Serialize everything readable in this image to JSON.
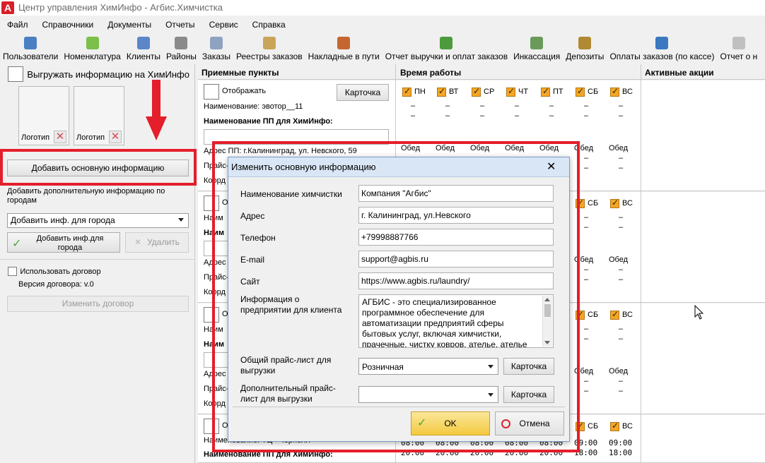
{
  "window": {
    "title": "Центр управления ХимИнфо - Агбис.Химчистка",
    "app_icon_letter": "A"
  },
  "menu": [
    "Файл",
    "Справочники",
    "Документы",
    "Отчеты",
    "Сервис",
    "Справка"
  ],
  "toolbar": [
    {
      "label": "Пользователи",
      "icon": "users-icon",
      "color": "#4a7fc1"
    },
    {
      "label": "Номенклатура",
      "icon": "catalog-icon",
      "color": "#7cbf4a"
    },
    {
      "label": "Клиенты",
      "icon": "client-icon",
      "color": "#5a87c8"
    },
    {
      "label": "Районы",
      "icon": "districts-icon",
      "color": "#8a8a8a"
    },
    {
      "label": "Заказы",
      "icon": "orders-icon",
      "color": "#8fa3c0"
    },
    {
      "label": "Реестры заказов",
      "icon": "registry-icon",
      "color": "#c9a55a"
    },
    {
      "label": "Накладные в пути",
      "icon": "truck-icon",
      "color": "#c4662f"
    },
    {
      "label": "Отчет выручки и оплат заказов",
      "icon": "books-icon",
      "color": "#4d9a3d"
    },
    {
      "label": "Инкассация",
      "icon": "money-icon",
      "color": "#6b9b5a"
    },
    {
      "label": "Депозиты",
      "icon": "deposit-icon",
      "color": "#b08a33"
    },
    {
      "label": "Оплаты заказов (по кассе)",
      "icon": "cashbox-icon",
      "color": "#3c78c0"
    },
    {
      "label": "Отчет о н",
      "icon": "report-icon",
      "color": "#c0c0c0"
    }
  ],
  "left": {
    "export_label": "Выгружать информацию на ХимИнфо",
    "logo_label": "Логотип",
    "add_main_btn": "Добавить основную информацию",
    "add_extra_text": "Добавить дополнительную информацию по городам",
    "city_select": "Добавить инф. для города",
    "add_city_btn": "Добавить инф.для города",
    "delete_btn": "Удалить",
    "use_contract": "Использовать договор",
    "contract_version": "Версия договора: v.0",
    "change_contract_btn": "Изменить договор"
  },
  "grid": {
    "col_points": "Приемные пункты",
    "col_hours": "Время работы",
    "col_promos": "Активные акции",
    "days": [
      "ПН",
      "ВТ",
      "СР",
      "ЧТ",
      "ПТ",
      "СБ",
      "ВС"
    ],
    "show_label": "Отображать",
    "card_btn": "Карточка",
    "name_row1": "Наименование: эвотор__11",
    "pp_name_label": "Наименование ПП для ХимИнфо:",
    "address_row1": "Адрес ПП: г.Калининград, ул. Невского, 59",
    "price_frag": "Прайс-",
    "coord_frag": "Коорд",
    "name_frag": "Наим",
    "addr_frag": "Адрес",
    "show_frag": "Ото",
    "lunch": "Обед",
    "dash": "–",
    "name_row4": "Наименование: ТЦ «Чернолл»",
    "times_open": "08:00",
    "times_close": "20:00",
    "sat_open": "09:00",
    "sat_close": "18:00",
    "sun_open": "09:00",
    "sun_close": "18:00"
  },
  "modal": {
    "title": "Изменить основную информацию",
    "fields": {
      "name_label": "Наименование химчистки",
      "name_value": "Компания \"Агбис\"",
      "address_label": "Адрес",
      "address_value": "г. Калининград, ул.Невского",
      "phone_label": "Телефон",
      "phone_value": "+79998887766",
      "email_label": "E-mail",
      "email_value": "support@agbis.ru",
      "site_label": "Сайт",
      "site_value": "https://www.agbis.ru/laundry/",
      "info_label": "Информация о предприятии для клиента",
      "info_value": "АГБИС - это специализированное программное обеспечение для автоматизации предприятий сферы бытовых услуг, включая химчистки, прачечные, чистку ковров, ателье, ателье по",
      "price_label": "Общий прайс-лист для выгрузки",
      "price_value": "Розничная",
      "extra_price_label": "Дополнительный прайс-лист для выгрузки",
      "extra_price_value": ""
    },
    "card_btn": "Карточка",
    "ok_btn": "OK",
    "cancel_btn": "Отмена"
  },
  "colors": {
    "highlight": "#e41e2b",
    "check_orange": "#f5a623",
    "ok_yellow": "#f7d54a"
  }
}
